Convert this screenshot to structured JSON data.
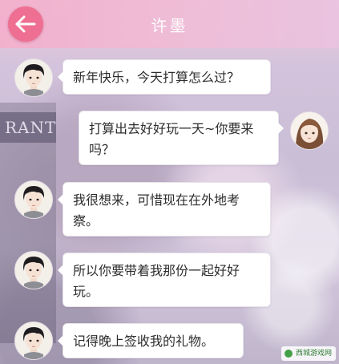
{
  "header": {
    "title": "许墨",
    "back_icon": "arrow-left-icon",
    "accent_color": "#ef6b8e"
  },
  "background": {
    "sign_text": "RANT"
  },
  "messages": [
    {
      "sender": "许墨",
      "side": "left",
      "avatar": "male-character-avatar",
      "text": "新年快乐，今天打算怎么过？"
    },
    {
      "sender": "me",
      "side": "right",
      "avatar": "female-character-avatar",
      "text": "打算出去好好玩一天~你要来吗？"
    },
    {
      "sender": "许墨",
      "side": "left",
      "avatar": "male-character-avatar",
      "text": "我很想来，可惜现在在外地考察。"
    },
    {
      "sender": "许墨",
      "side": "left",
      "avatar": "male-character-avatar",
      "text": "所以你要带着我那份一起好好玩。"
    },
    {
      "sender": "许墨",
      "side": "left",
      "avatar": "male-character-avatar",
      "text": "记得晚上签收我的礼物。"
    }
  ],
  "watermark": {
    "text": "西城游戏网"
  }
}
